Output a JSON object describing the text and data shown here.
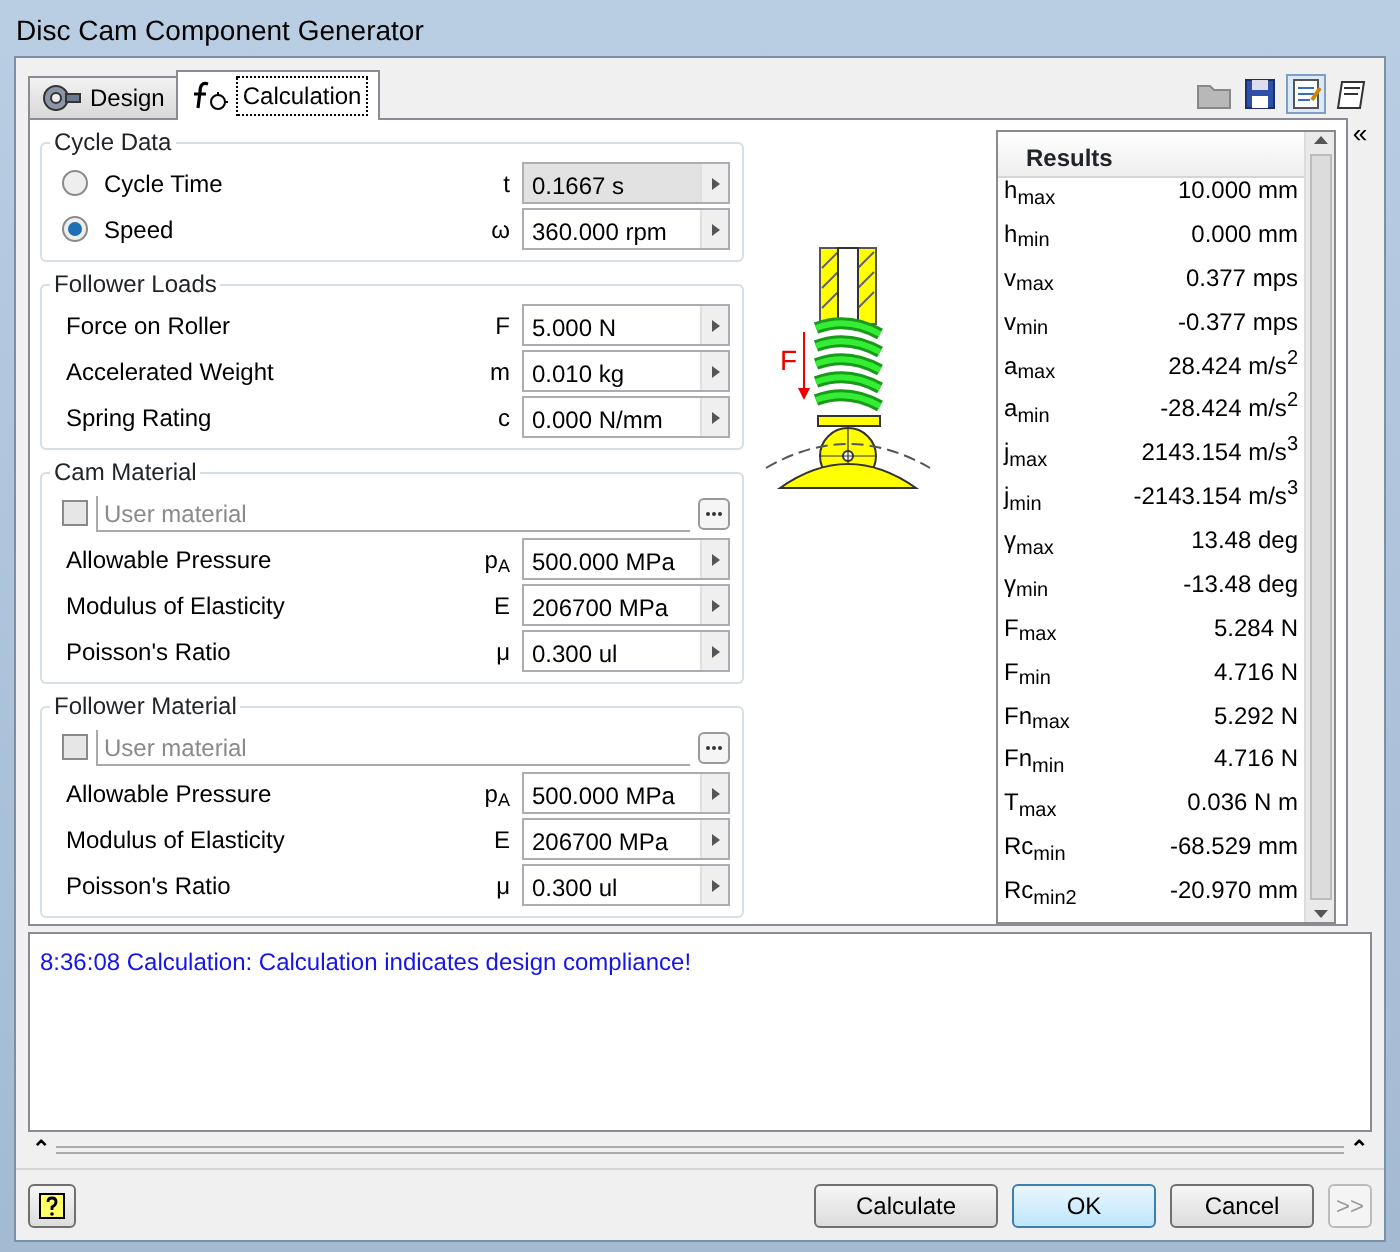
{
  "window": {
    "title": "Disc Cam Component Generator"
  },
  "tabs": [
    {
      "label": "Design",
      "selected": false
    },
    {
      "label": "Calculation",
      "selected": true
    }
  ],
  "toolbar": [
    {
      "selected": false
    },
    {
      "selected": false
    },
    {
      "selected": true
    },
    {
      "selected": false
    }
  ],
  "groups": [
    {
      "title": "Cycle Data",
      "rows": [
        {
          "kind": "radio",
          "label": "Cycle Time",
          "selected": false,
          "symbol": "t",
          "value": "0.1667 s",
          "disabled": true
        },
        {
          "kind": "radio",
          "label": "Speed",
          "selected": true,
          "symbol": "ω",
          "value": "360.000 rpm",
          "disabled": false
        }
      ]
    },
    {
      "title": "Follower Loads",
      "rows": [
        {
          "kind": "field",
          "label": "Force on Roller",
          "symbol": "F",
          "value": "5.000 N",
          "disabled": false
        },
        {
          "kind": "field",
          "label": "Accelerated Weight",
          "symbol": "m",
          "value": "0.010 kg",
          "disabled": false
        },
        {
          "kind": "field",
          "label": "Spring Rating",
          "symbol": "c",
          "value": "0.000 N/mm",
          "disabled": false
        }
      ]
    },
    {
      "title": "Cam Material",
      "rows": [
        {
          "kind": "material",
          "checked": false,
          "placeholder": "User material"
        },
        {
          "kind": "field",
          "label": "Allowable Pressure",
          "symbol": "p$_{A}$",
          "value": "500.000 MPa",
          "disabled": false
        },
        {
          "kind": "field",
          "label": "Modulus of Elasticity",
          "symbol": "E",
          "value": "206700 MPa",
          "disabled": false
        },
        {
          "kind": "field",
          "label": "Poisson's Ratio",
          "symbol": "μ",
          "value": "0.300 ul",
          "disabled": false
        }
      ]
    },
    {
      "title": "Follower Material",
      "rows": [
        {
          "kind": "material",
          "checked": false,
          "placeholder": "User material"
        },
        {
          "kind": "field",
          "label": "Allowable Pressure",
          "symbol": "p$_{A}$",
          "value": "500.000 MPa",
          "disabled": false
        },
        {
          "kind": "field",
          "label": "Modulus of Elasticity",
          "symbol": "E",
          "value": "206700 MPa",
          "disabled": false
        },
        {
          "kind": "field",
          "label": "Poisson's Ratio",
          "symbol": "μ",
          "value": "0.300 ul",
          "disabled": false
        }
      ]
    }
  ],
  "diagram": {
    "force_label": "F"
  },
  "results": {
    "title": "Results",
    "rows": [
      {
        "name": "h$_{max}$",
        "value": "10.000 mm"
      },
      {
        "name": "h$_{min}$",
        "value": "0.000 mm"
      },
      {
        "name": "v$_{max}$",
        "value": "0.377 mps"
      },
      {
        "name": "v$_{min}$",
        "value": "-0.377 mps"
      },
      {
        "name": "a$_{max}$",
        "value": "28.424 m/s$^{2}$"
      },
      {
        "name": "a$_{min}$",
        "value": "-28.424 m/s$^{2}$"
      },
      {
        "name": "j$_{max}$",
        "value": "2143.154 m/s$^{3}$"
      },
      {
        "name": "j$_{min}$",
        "value": "-2143.154 m/s$^{3}$"
      },
      {
        "name": "γ$_{max}$",
        "value": "13.48 deg"
      },
      {
        "name": "γ$_{min}$",
        "value": "-13.48 deg"
      },
      {
        "name": "F$_{max}$",
        "value": "5.284 N"
      },
      {
        "name": "F$_{min}$",
        "value": "4.716 N"
      },
      {
        "name": "Fn$_{max}$",
        "value": "5.292 N"
      },
      {
        "name": "Fn$_{min}$",
        "value": "4.716 N"
      },
      {
        "name": "T$_{max}$",
        "value": "0.036 N m"
      },
      {
        "name": "Rc$_{min}$",
        "value": "-68.529 mm"
      },
      {
        "name": "Rc$_{min2}$",
        "value": "-20.970 mm"
      }
    ]
  },
  "messages": [
    "8:36:08 Calculation: Calculation indicates design compliance!"
  ],
  "side_toggle": "«",
  "splitter": {
    "left": "⌃",
    "right": "⌃"
  },
  "buttons": [
    {
      "label": "Calculate",
      "default": false,
      "disabled": false
    },
    {
      "label": "OK",
      "default": true,
      "disabled": false
    },
    {
      "label": "Cancel",
      "default": false,
      "disabled": false
    },
    {
      "label": ">>",
      "default": false,
      "disabled": true
    }
  ]
}
